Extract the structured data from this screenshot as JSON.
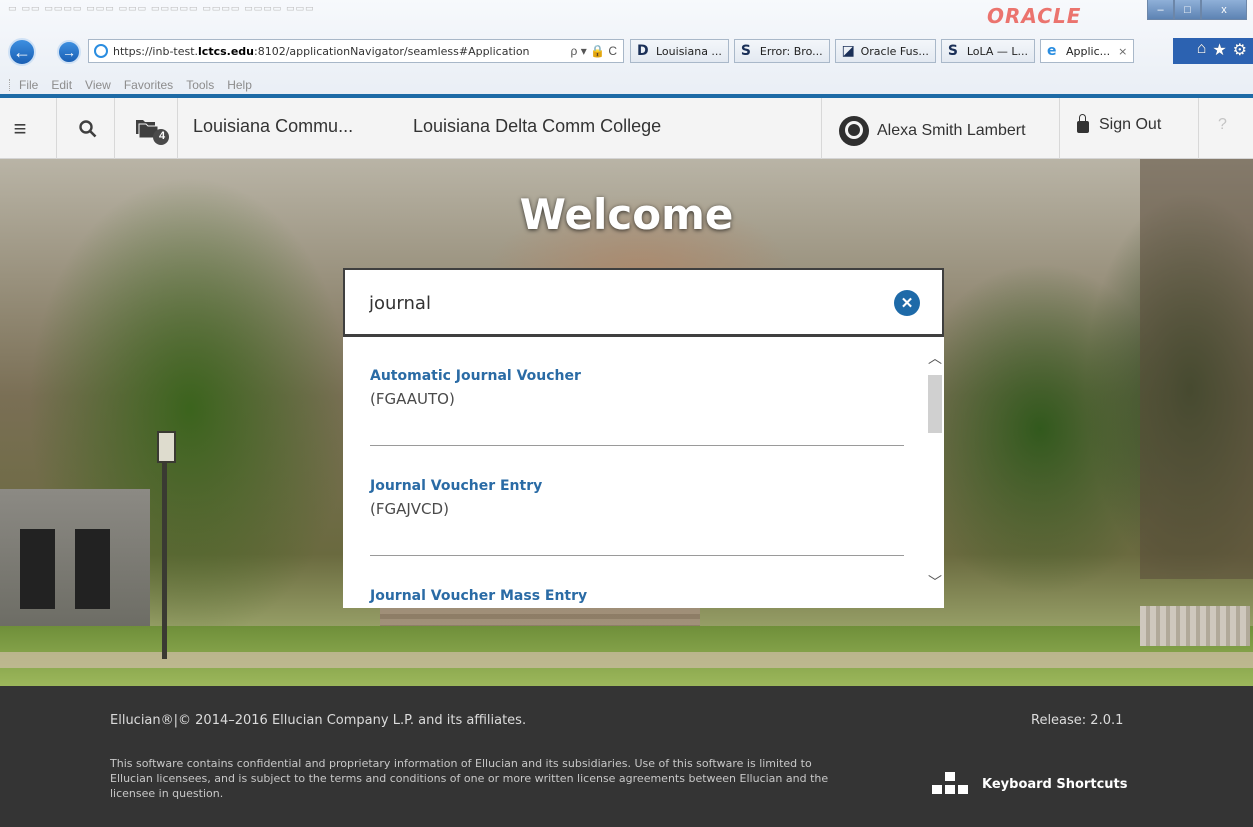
{
  "browser": {
    "brand": "ORACLE",
    "url_prefix": "https://inb-test.",
    "url_domain": "lctcs.edu",
    "url_suffix": ":8102/applicationNavigator/seamless#Application",
    "address_tools": "ρ ▾ 🔒 C",
    "tabs": [
      {
        "icon": "D",
        "label": "Louisiana ..."
      },
      {
        "icon": "S",
        "label": "Error: Bro..."
      },
      {
        "icon": "◪",
        "label": "Oracle Fus..."
      },
      {
        "icon": "S",
        "label": "LoLA — L..."
      },
      {
        "icon": "e",
        "label": "Applic...",
        "close": "×"
      }
    ],
    "menu": [
      "File",
      "Edit",
      "View",
      "Favorites",
      "Tools",
      "Help"
    ],
    "window_controls": [
      "–",
      "□",
      "x"
    ],
    "toolbar_icons": [
      "⌂",
      "★",
      "⚙"
    ]
  },
  "header": {
    "recent_count": "4",
    "institution": "Louisiana Commu...",
    "college": "Louisiana Delta Comm College",
    "user_name": "Alexa Smith Lambert",
    "sign_out": "Sign Out",
    "help": "?"
  },
  "welcome": "Welcome",
  "search": {
    "value": "journal",
    "results": [
      {
        "name": "Automatic Journal Voucher",
        "code": "(FGAAUTO)"
      },
      {
        "name": "Journal Voucher Entry",
        "code": "(FGAJVCD)"
      },
      {
        "name": "Journal Voucher Mass Entry",
        "code": ""
      }
    ]
  },
  "footer": {
    "copyright": "Ellucian®|© 2014–2016 Ellucian Company L.P. and its affiliates.",
    "release": "Release: 2.0.1",
    "legal": "This software contains confidential and proprietary information of Ellucian and its subsidiaries. Use of this software is limited to Ellucian licensees, and is subject to the terms and conditions of one or more written license agreements between Ellucian and the licensee in question.",
    "keyboard_shortcuts": "Keyboard Shortcuts"
  },
  "colors": {
    "accent_blue": "#1e6aa8",
    "link_blue": "#2a6ba5",
    "footer_bg": "#343434",
    "oracle_red": "#e8483f"
  }
}
